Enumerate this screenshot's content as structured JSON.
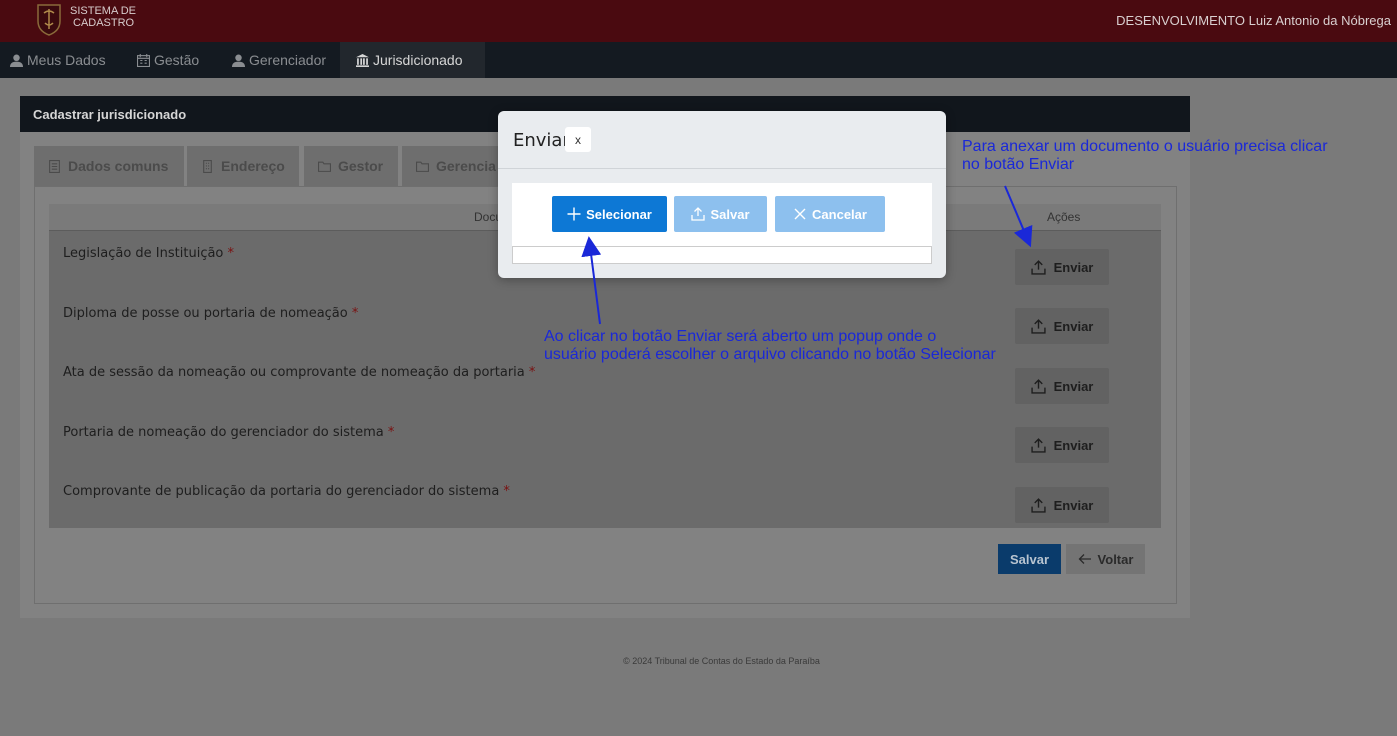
{
  "header": {
    "brand_line1": "SISTEMA DE",
    "brand_line2": "CADASTRO",
    "user": "DESENVOLVIMENTO Luiz Antonio da Nóbrega"
  },
  "nav": {
    "items": [
      {
        "label": "Meus Dados",
        "icon": "user-icon"
      },
      {
        "label": "Gestão",
        "icon": "calendar-icon"
      },
      {
        "label": "Gerenciador",
        "icon": "user-icon"
      },
      {
        "label": "Jurisdicionado",
        "icon": "institution-icon",
        "active": true
      }
    ]
  },
  "card": {
    "title": "Cadastrar jurisdicionado",
    "tabs": [
      {
        "label": "Dados comuns",
        "icon": "document-icon"
      },
      {
        "label": "Endereço",
        "icon": "building-icon"
      },
      {
        "label": "Gestor",
        "icon": "folder-icon"
      },
      {
        "label": "Gerencia",
        "icon": "folder-icon"
      }
    ],
    "table": {
      "col_documents": "Docu",
      "col_actions": "Ações",
      "rows": [
        {
          "label": "Legislação de Instituição",
          "required": "*",
          "action": "Enviar"
        },
        {
          "label": "Diploma de posse ou portaria de nomeação",
          "required": "*",
          "action": "Enviar"
        },
        {
          "label": "Ata de sessão da nomeação ou comprovante de nomeação da portaria",
          "required": "*",
          "action": "Enviar"
        },
        {
          "label": "Portaria de nomeação do gerenciador do sistema",
          "required": "*",
          "action": "Enviar"
        },
        {
          "label": "Comprovante de publicação da portaria do gerenciador do sistema",
          "required": "*",
          "action": "Enviar"
        }
      ]
    },
    "save_label": "Salvar",
    "back_label": "Voltar"
  },
  "footer": "© 2024 Tribunal de Contas do Estado da Paraíba",
  "modal": {
    "title": "Enviar",
    "close_label": "x",
    "select_label": "Selecionar",
    "save_label": "Salvar",
    "cancel_label": "Cancelar"
  },
  "annotations": {
    "top_right": [
      "Para anexar um documento o usuário precisa clicar",
      "no botão Enviar"
    ],
    "center": [
      "Ao clicar no botão Enviar será aberto um popup onde o",
      "usuário poderá escolher o arquivo clicando no botão Selecionar"
    ]
  },
  "colors": {
    "header": "#4a0a10",
    "annotation": "#1a28d8",
    "primary": "#0d78d5"
  }
}
